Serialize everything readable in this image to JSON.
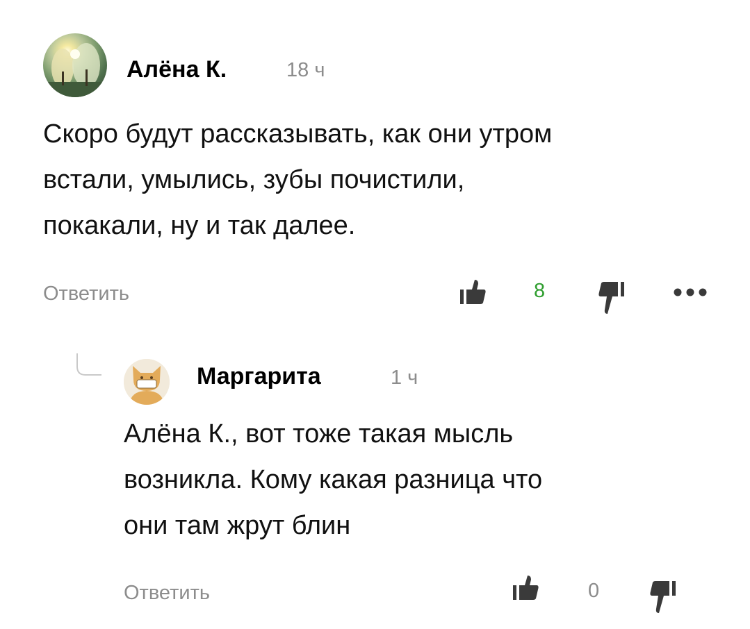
{
  "comments": [
    {
      "author": "Алёна К.",
      "time": "18 ч",
      "text_lines": [
        "Скоро будут рассказывать, как они утром",
        "встали, умылись, зубы почистили,",
        "покакали, ну и так далее."
      ],
      "reply_label": "Ответить",
      "likes": "8",
      "likes_color": "#2f9e2f",
      "avatar_icon": "winter-tree-photo-avatar"
    },
    {
      "author": "Маргарита",
      "time": "1 ч",
      "text_lines": [
        "Алёна К., вот тоже такая мысль",
        "возникла. Кому какая разница что",
        "они там жрут блин"
      ],
      "reply_label": "Ответить",
      "likes": "0",
      "likes_color": "#8c8c8c",
      "avatar_icon": "cat-avatar"
    }
  ],
  "colors": {
    "muted": "#8c8c8c",
    "icon": "#3a3a3a",
    "cat": "#e3ab5a"
  }
}
